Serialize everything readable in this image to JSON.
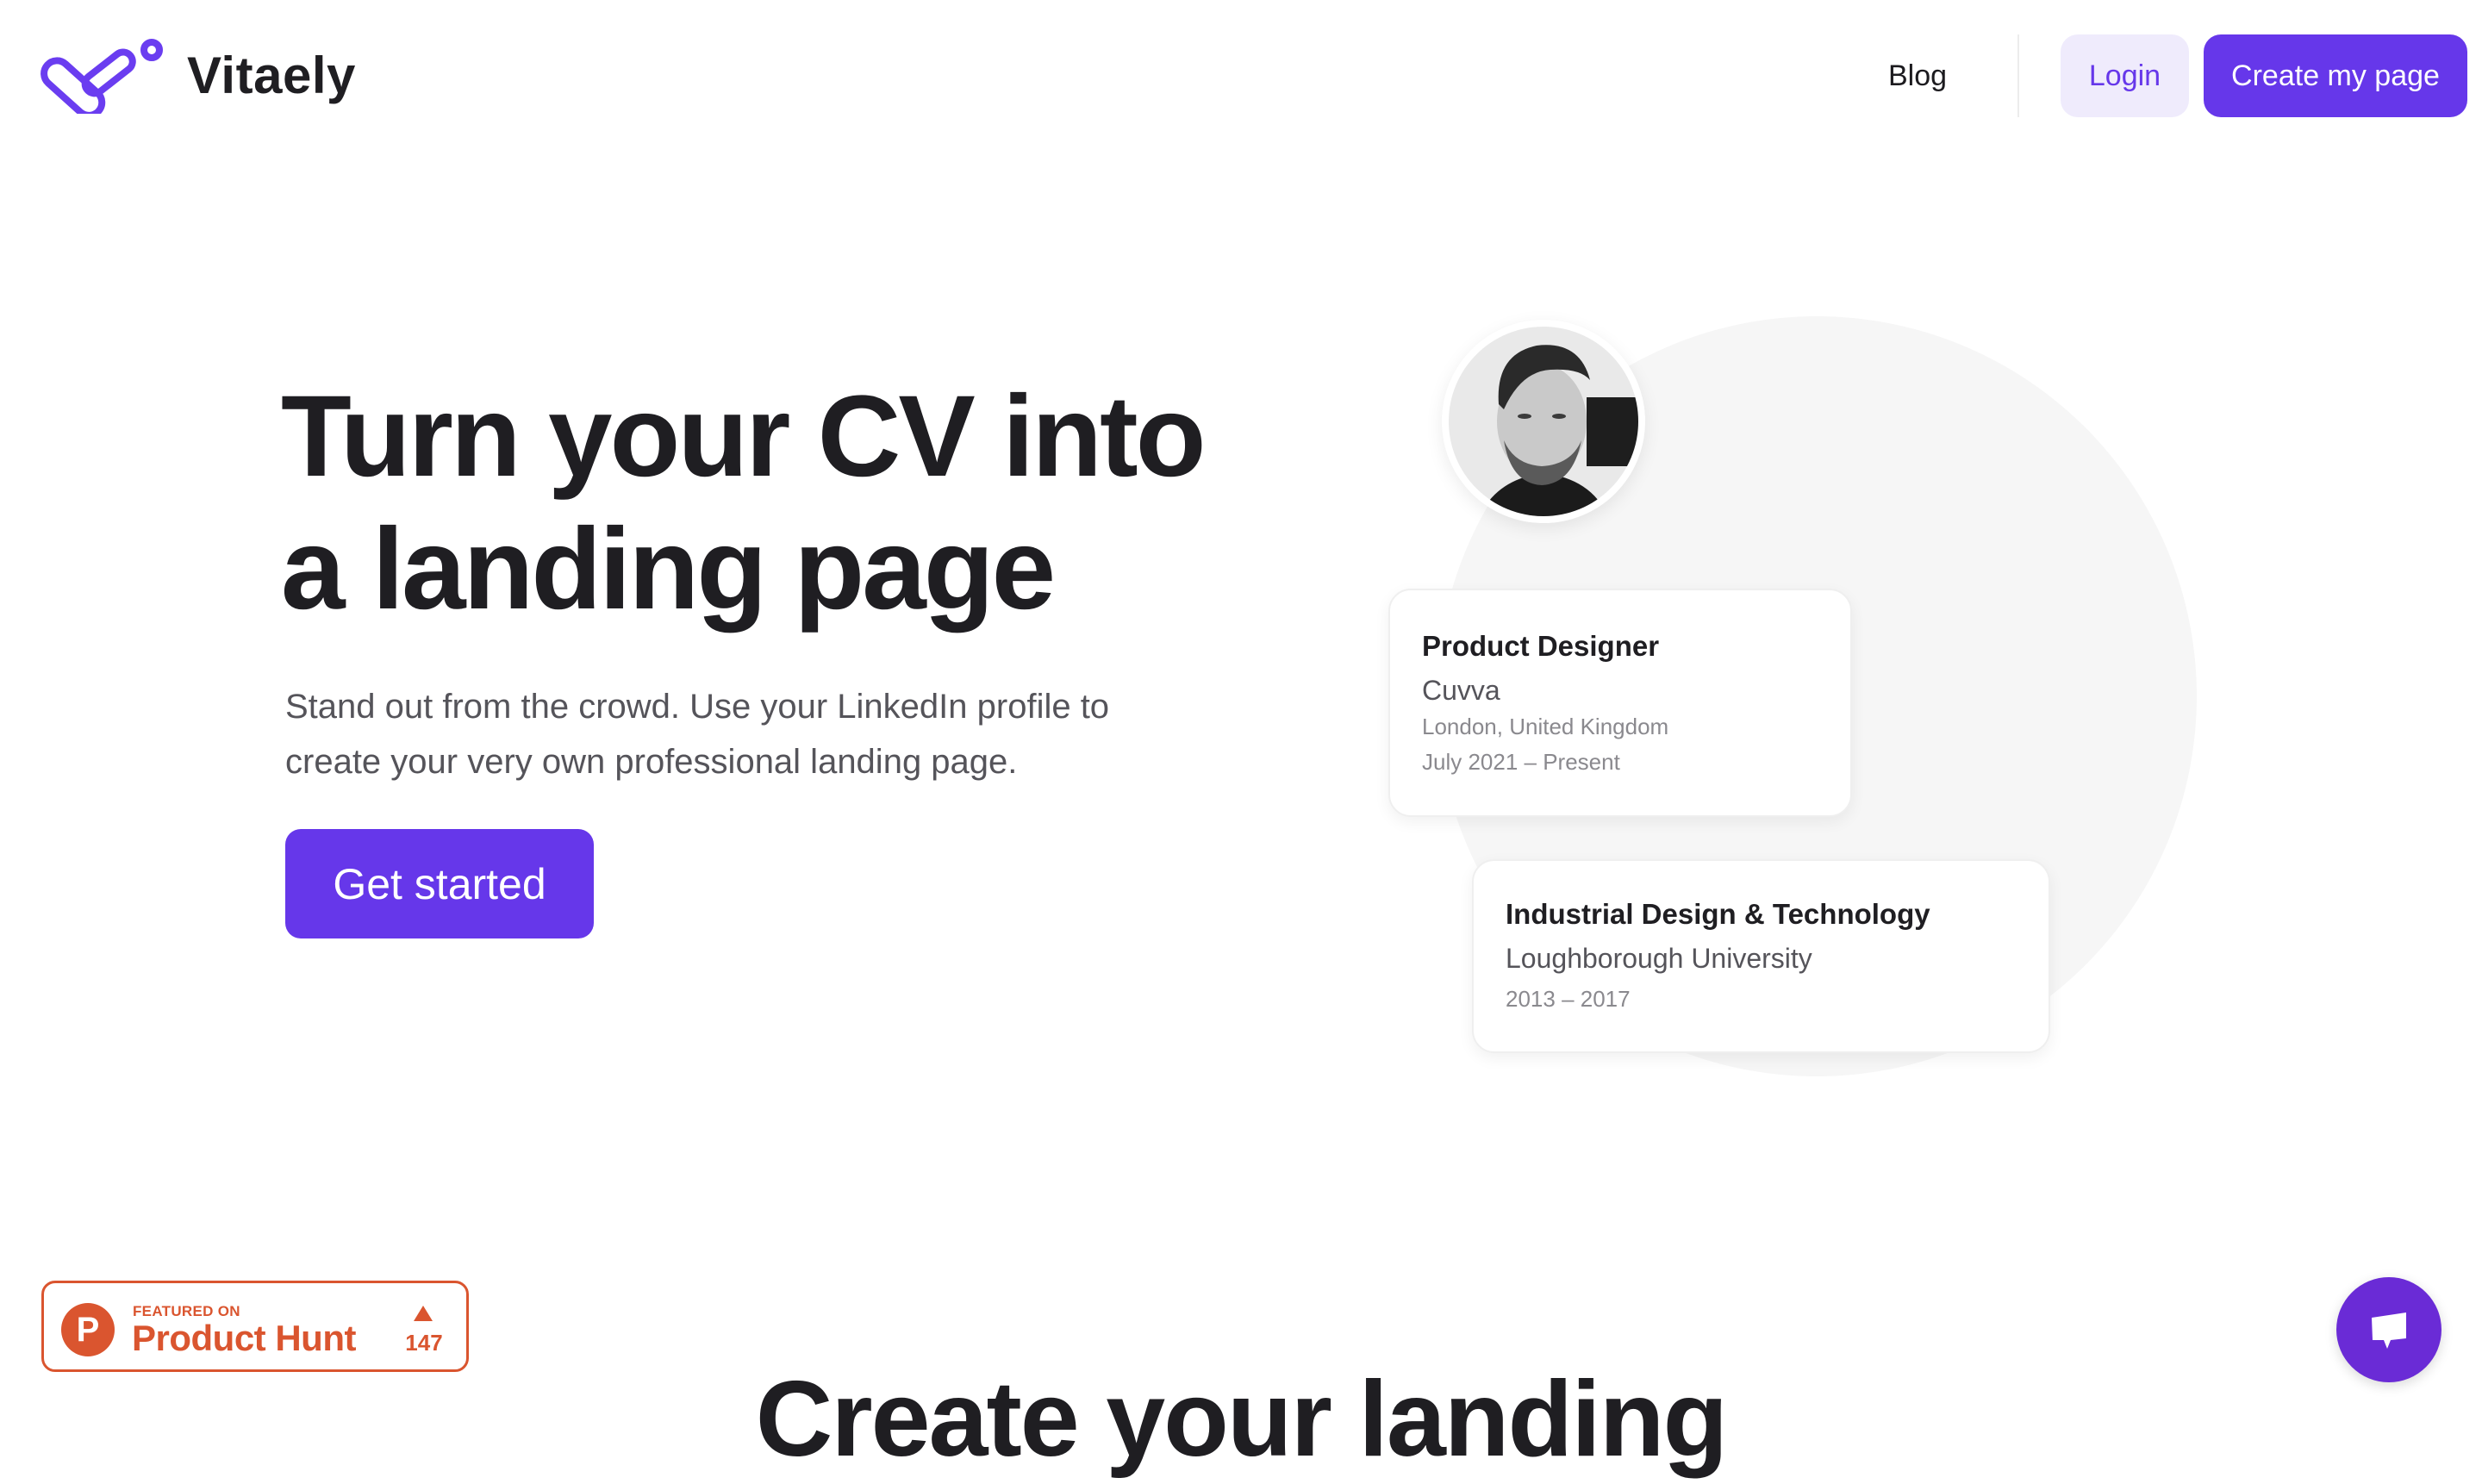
{
  "header": {
    "brand": "Vitaely",
    "logo_icon": "vitaely-logo-icon",
    "nav": [
      {
        "label": "Blog"
      }
    ],
    "login_label": "Login",
    "cta_label": "Create my page"
  },
  "hero": {
    "headline_line1": "Turn your CV into",
    "headline_line2": "a landing page",
    "subtext_line1": "Stand out from the crowd. Use your LinkedIn profile to",
    "subtext_line2": "create your very own professional landing page.",
    "cta_label": "Get started"
  },
  "profile_preview": {
    "avatar_icon": "profile-photo",
    "experience": {
      "title": "Product Designer",
      "company": "Cuvva",
      "location": "London, United Kingdom",
      "dates": "July 2021 – Present"
    },
    "education": {
      "degree": "Industrial Design & Technology",
      "school": "Loughborough University",
      "dates": "2013 – 2017"
    }
  },
  "product_hunt": {
    "logo_letter": "P",
    "featured_label": "FEATURED ON",
    "name": "Product Hunt",
    "upvote_icon": "triangle-up-icon",
    "count": "147"
  },
  "chat": {
    "icon": "chat-bubble-icon"
  },
  "section2": {
    "heading": "Create your landing"
  },
  "colors": {
    "brand": "#6637ea",
    "brand_light": "#efebfc",
    "text_dark": "#1f1e22",
    "text_muted": "#55545a",
    "product_hunt": "#da552f",
    "chat": "#6a2bd6"
  }
}
